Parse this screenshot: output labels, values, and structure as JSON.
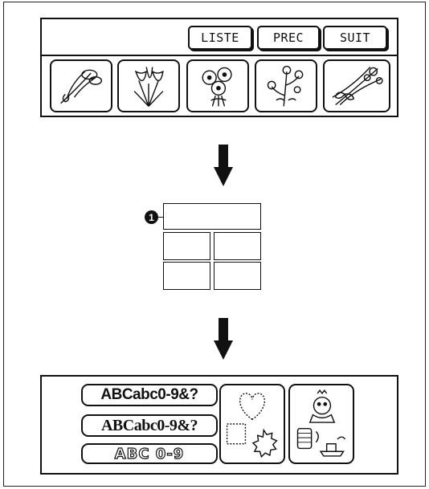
{
  "top_panel": {
    "buttons": {
      "list": "LISTE",
      "prev": "PREC",
      "next": "SUIT"
    },
    "pattern_icons": [
      "flower-bouquet-1-icon",
      "tulip-bouquet-icon",
      "daisy-bouquet-icon",
      "flower-spray-icon",
      "bouquet-with-ribbon-icon"
    ]
  },
  "middle": {
    "callout_number": "1"
  },
  "bottom_panel": {
    "font_samples": [
      "ABCabc0-9&?",
      "ABCabc0-9&?",
      "ABC 0-9"
    ],
    "design_icons": [
      "heart-frame-icon",
      "square-frame-icon",
      "sun-frame-icon",
      "character-thread-icon"
    ]
  },
  "colors": {
    "line": "#111111",
    "background": "#ffffff"
  }
}
